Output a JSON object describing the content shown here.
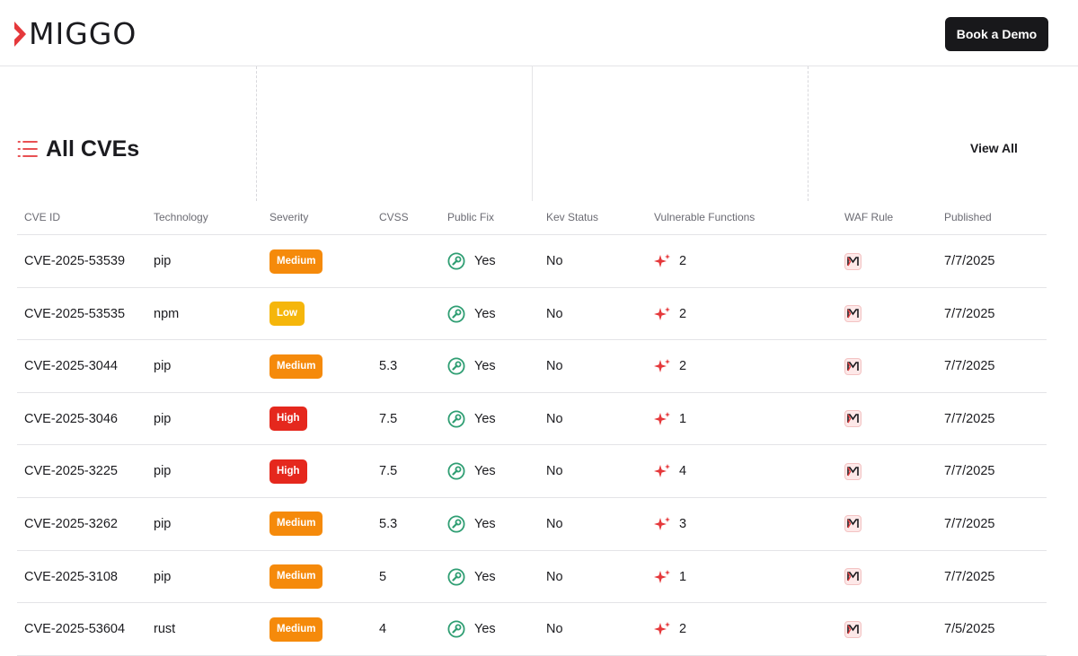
{
  "header": {
    "logo_text": "MIGGO",
    "demo_button": "Book a Demo"
  },
  "section": {
    "title": "All CVEs",
    "view_all": "View All",
    "icon": "list-icon"
  },
  "table": {
    "columns": [
      "CVE ID",
      "Technology",
      "Severity",
      "CVSS",
      "Public Fix",
      "Kev Status",
      "Vulnerable Functions",
      "WAF Rule",
      "Published"
    ],
    "rows": [
      {
        "cve": "CVE-2025-53539",
        "tech": "pip",
        "severity": "Medium",
        "sev_class": "medium",
        "cvss": "",
        "fix": "Yes",
        "kev": "No",
        "vf": "2",
        "published": "7/7/2025"
      },
      {
        "cve": "CVE-2025-53535",
        "tech": "npm",
        "severity": "Low",
        "sev_class": "low",
        "cvss": "",
        "fix": "Yes",
        "kev": "No",
        "vf": "2",
        "published": "7/7/2025"
      },
      {
        "cve": "CVE-2025-3044",
        "tech": "pip",
        "severity": "Medium",
        "sev_class": "medium",
        "cvss": "5.3",
        "fix": "Yes",
        "kev": "No",
        "vf": "2",
        "published": "7/7/2025"
      },
      {
        "cve": "CVE-2025-3046",
        "tech": "pip",
        "severity": "High",
        "sev_class": "high",
        "cvss": "7.5",
        "fix": "Yes",
        "kev": "No",
        "vf": "1",
        "published": "7/7/2025"
      },
      {
        "cve": "CVE-2025-3225",
        "tech": "pip",
        "severity": "High",
        "sev_class": "high",
        "cvss": "7.5",
        "fix": "Yes",
        "kev": "No",
        "vf": "4",
        "published": "7/7/2025"
      },
      {
        "cve": "CVE-2025-3262",
        "tech": "pip",
        "severity": "Medium",
        "sev_class": "medium",
        "cvss": "5.3",
        "fix": "Yes",
        "kev": "No",
        "vf": "3",
        "published": "7/7/2025"
      },
      {
        "cve": "CVE-2025-3108",
        "tech": "pip",
        "severity": "Medium",
        "sev_class": "medium",
        "cvss": "5",
        "fix": "Yes",
        "kev": "No",
        "vf": "1",
        "published": "7/7/2025"
      },
      {
        "cve": "CVE-2025-53604",
        "tech": "rust",
        "severity": "Medium",
        "sev_class": "medium",
        "cvss": "4",
        "fix": "Yes",
        "kev": "No",
        "vf": "2",
        "published": "7/5/2025"
      }
    ]
  },
  "colors": {
    "accent": "#e5383b",
    "medium": "#f58a0b",
    "low": "#f5b60b",
    "high": "#e5281d",
    "fix_green": "#2f9e73",
    "button_dark": "#18181b"
  },
  "icons": {
    "public_fix": "wrench-check-icon",
    "vulnerable_functions": "sparkle-icon",
    "waf_rule": "miggo-m-icon"
  }
}
